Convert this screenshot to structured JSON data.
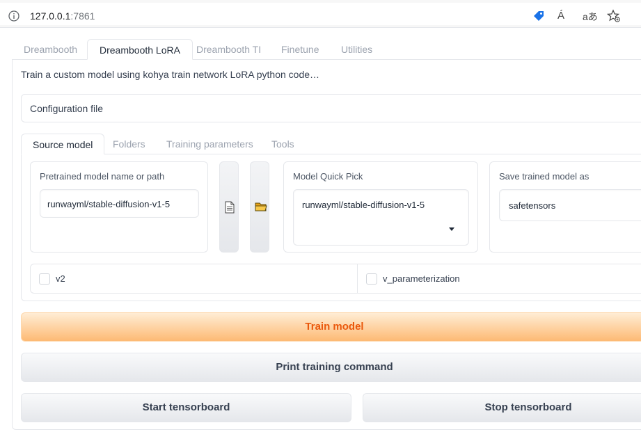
{
  "browser": {
    "url_host": "127.0.0.1",
    "url_port": ":7861",
    "icons": [
      "info-icon",
      "tag-icon",
      "read-aloud-icon",
      "translate-icon",
      "favorites-icon"
    ],
    "read_aloud_text": "Á",
    "translate_text": "aあ"
  },
  "top_tabs": [
    {
      "label": "Dreambooth"
    },
    {
      "label": "Dreambooth LoRA"
    },
    {
      "label": "Dreambooth TI"
    },
    {
      "label": "Finetune"
    },
    {
      "label": "Utilities"
    }
  ],
  "description": "Train a custom model using kohya train network LoRA python code…",
  "config_file_label": "Configuration file",
  "sub_tabs": [
    {
      "label": "Source model"
    },
    {
      "label": "Folders"
    },
    {
      "label": "Training parameters"
    },
    {
      "label": "Tools"
    }
  ],
  "source_model": {
    "pretrained_label": "Pretrained model name or path",
    "pretrained_value": "runwayml/stable-diffusion-v1-5",
    "quick_pick_label": "Model Quick Pick",
    "quick_pick_value": "runwayml/stable-diffusion-v1-5",
    "save_as_label": "Save trained model as",
    "save_as_value": "safetensors",
    "v2_label": "v2",
    "v_param_label": "v_parameterization"
  },
  "buttons": {
    "train": "Train model",
    "print": "Print training command",
    "start_tb": "Start tensorboard",
    "stop_tb": "Stop tensorboard"
  },
  "colors": {
    "accent": "#ea580c",
    "primary_from": "#ffedd5",
    "primary_to": "#fdba74"
  }
}
